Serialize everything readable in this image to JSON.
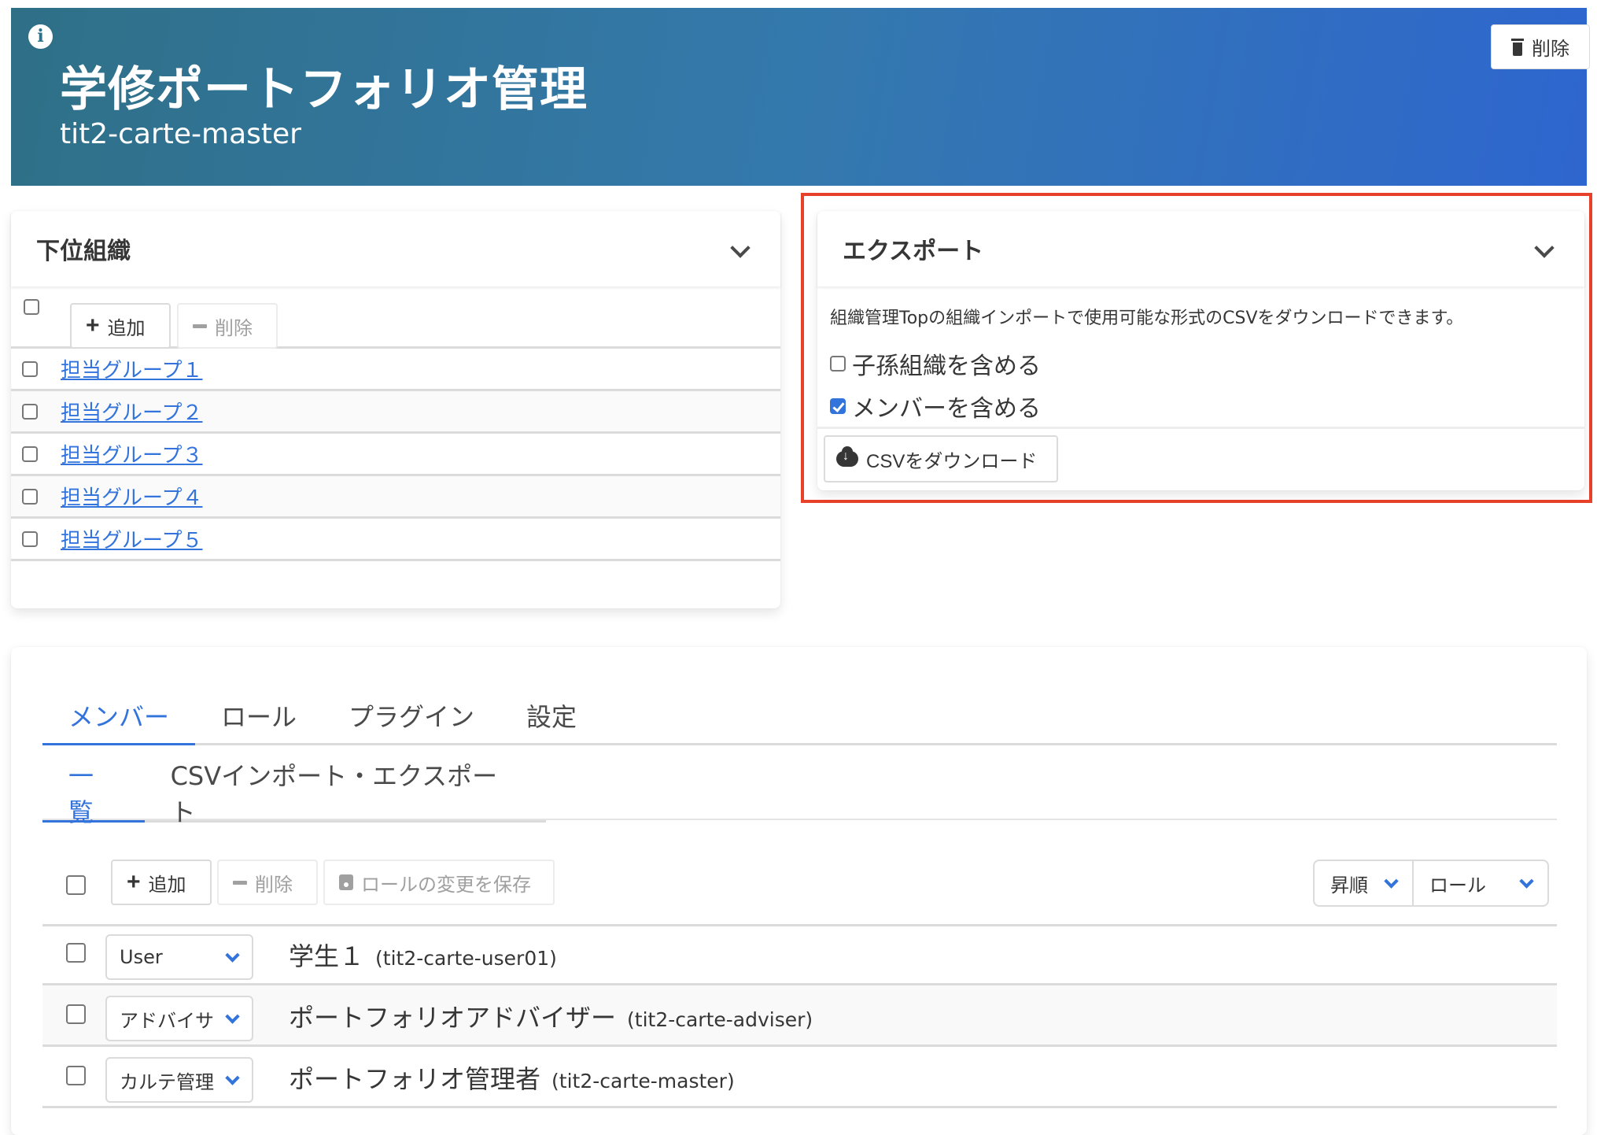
{
  "header": {
    "title": "学修ポートフォリオ管理",
    "subtitle": "tit2-carte-master",
    "info_icon": "info-circle-icon",
    "delete_label": "削除",
    "delete_icon": "trash-icon"
  },
  "sub_org": {
    "title": "下位組織",
    "add_label": "追加",
    "delete_label": "削除",
    "items": [
      {
        "label": "担当グループ１",
        "checked": false
      },
      {
        "label": "担当グループ２",
        "checked": false
      },
      {
        "label": "担当グループ３",
        "checked": false
      },
      {
        "label": "担当グループ４",
        "checked": false
      },
      {
        "label": "担当グループ５",
        "checked": false
      }
    ]
  },
  "export": {
    "title": "エクスポート",
    "description": "組織管理Topの組織インポートで使用可能な形式のCSVをダウンロードできます。",
    "options": [
      {
        "label": "子孫組織を含める",
        "checked": false
      },
      {
        "label": "メンバーを含める",
        "checked": true
      }
    ],
    "download_label": "CSVをダウンロード",
    "download_icon": "cloud-download-icon",
    "highlight_color": "#e8412a"
  },
  "members_panel": {
    "tabs": [
      {
        "label": "メンバー",
        "active": true
      },
      {
        "label": "ロール",
        "active": false
      },
      {
        "label": "プラグイン",
        "active": false
      },
      {
        "label": "設定",
        "active": false
      }
    ],
    "sub_tabs": [
      {
        "label": "一覧",
        "active": true
      },
      {
        "label": "CSVインポート・エクスポート",
        "active": false
      }
    ],
    "toolbar": {
      "add_label": "追加",
      "delete_label": "削除",
      "save_roles_label": "ロールの変更を保存",
      "sort_order": "昇順",
      "sort_field": "ロール"
    },
    "members": [
      {
        "role": "User",
        "name": "学生１",
        "id": "(tit2-carte-user01)"
      },
      {
        "role": "アドバイサ",
        "name": "ポートフォリオアドバイザー",
        "id": "(tit2-carte-adviser)"
      },
      {
        "role": "カルテ管理",
        "name": "ポートフォリオ管理者",
        "id": "(tit2-carte-master)"
      }
    ]
  },
  "colors": {
    "accent": "#3273dc",
    "header_gradient_start": "#2f7087",
    "header_gradient_end": "#2e66cf"
  }
}
